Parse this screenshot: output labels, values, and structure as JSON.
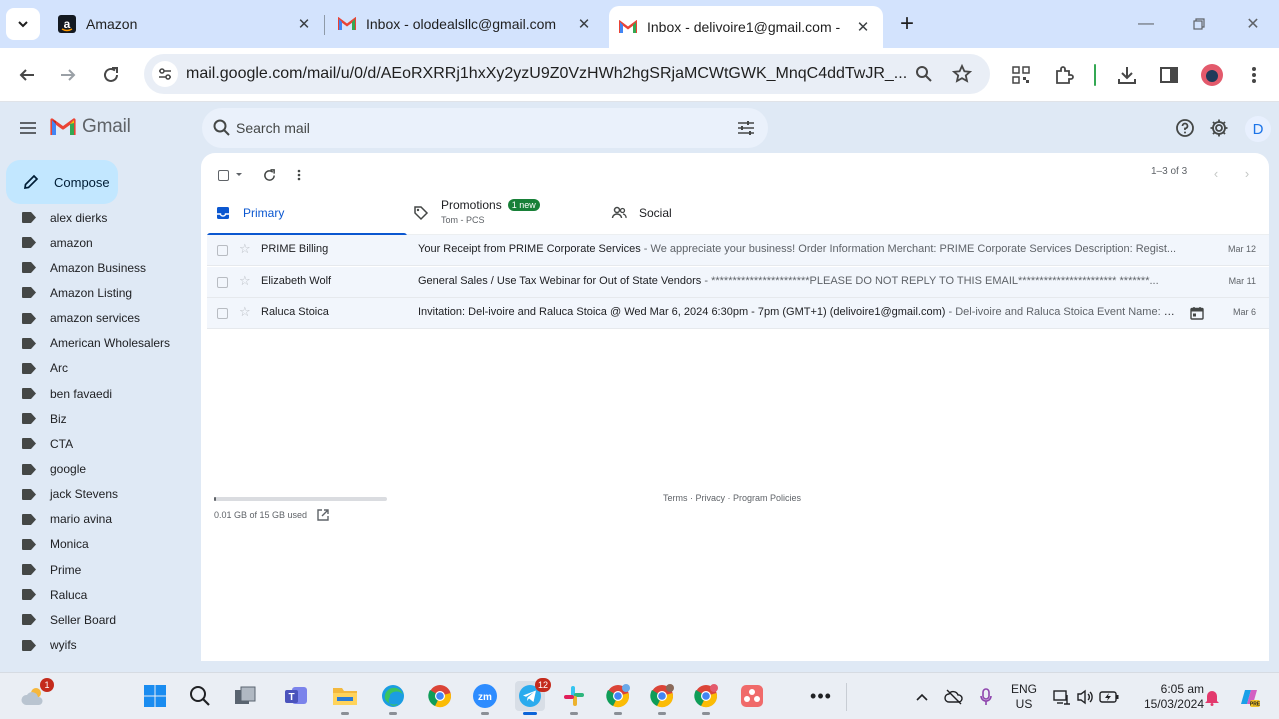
{
  "browser": {
    "tabs": [
      {
        "title": "Amazon",
        "favicon": "amazon-icon",
        "active": false
      },
      {
        "title": "Inbox - olodealsllc@gmail.com",
        "favicon": "gmail-icon",
        "active": false
      },
      {
        "title": "Inbox - delivoire1@gmail.com -",
        "favicon": "gmail-icon",
        "active": true
      }
    ],
    "url": "mail.google.com/mail/u/0/d/AEoRXRRj1hxXy2yzU9Z0VzHWh2hgSRjaMCWtGWK_MnqC4ddTwJR_..."
  },
  "gmail": {
    "logo_text": "Gmail",
    "search_placeholder": "Search mail",
    "avatar_initial": "D",
    "compose_label": "Compose",
    "labels": [
      "alex dierks",
      "amazon",
      "Amazon Business",
      "Amazon Listing",
      "amazon services",
      "American Wholesalers",
      "Arc",
      "ben favaedi",
      "Biz",
      "CTA",
      "google",
      "jack Stevens",
      "mario avina",
      "Monica",
      "Prime",
      "Raluca",
      "Seller Board",
      "wyifs"
    ],
    "pager": "1–3 of 3",
    "categories": [
      {
        "label": "Primary",
        "sub": "",
        "badge": "",
        "icon": "inbox-icon"
      },
      {
        "label": "Promotions",
        "sub": "Tom - PCS",
        "badge": "1 new",
        "icon": "tag-icon"
      },
      {
        "label": "Social",
        "sub": "",
        "badge": "",
        "icon": "people-icon"
      }
    ],
    "emails": [
      {
        "sender": "PRIME Billing",
        "subject": "Your Receipt from PRIME Corporate Services",
        "preview": " - We appreciate your business! Order Information Merchant: PRIME Corporate Services Description: Regist...",
        "date": "Mar 12",
        "has_calendar": false
      },
      {
        "sender": "Elizabeth Wolf",
        "subject": "General Sales / Use Tax Webinar for Out of State Vendors",
        "preview": " - ***********************PLEASE DO NOT REPLY TO THIS EMAIL*********************** *******...",
        "date": "Mar 11",
        "has_calendar": false
      },
      {
        "sender": "Raluca Stoica",
        "subject": "Invitation: Del-ivoire and Raluca Stoica @ Wed Mar 6, 2024 6:30pm - 7pm (GMT+1) (delivoire1@gmail.com)",
        "preview": " - Del-ivoire and Raluca Stoica Event Name: W...",
        "date": "Mar 6",
        "has_calendar": true
      }
    ],
    "storage_text": "0.01 GB of 15 GB used",
    "storage_fraction": 0.01,
    "footer": {
      "terms": "Terms",
      "privacy": "Privacy",
      "policies": "Program Policies",
      "sep": " · "
    }
  },
  "taskbar": {
    "weather_badge": "1",
    "telegram_badge": "12",
    "lang_line1": "ENG",
    "lang_line2": "US",
    "time": "6:05 am",
    "date": "15/03/2024"
  },
  "colors": {
    "accent": "#0b57d0",
    "compose_bg": "#c2e7ff",
    "new_badge": "#188038",
    "row_bg": "#f2f6fc"
  }
}
